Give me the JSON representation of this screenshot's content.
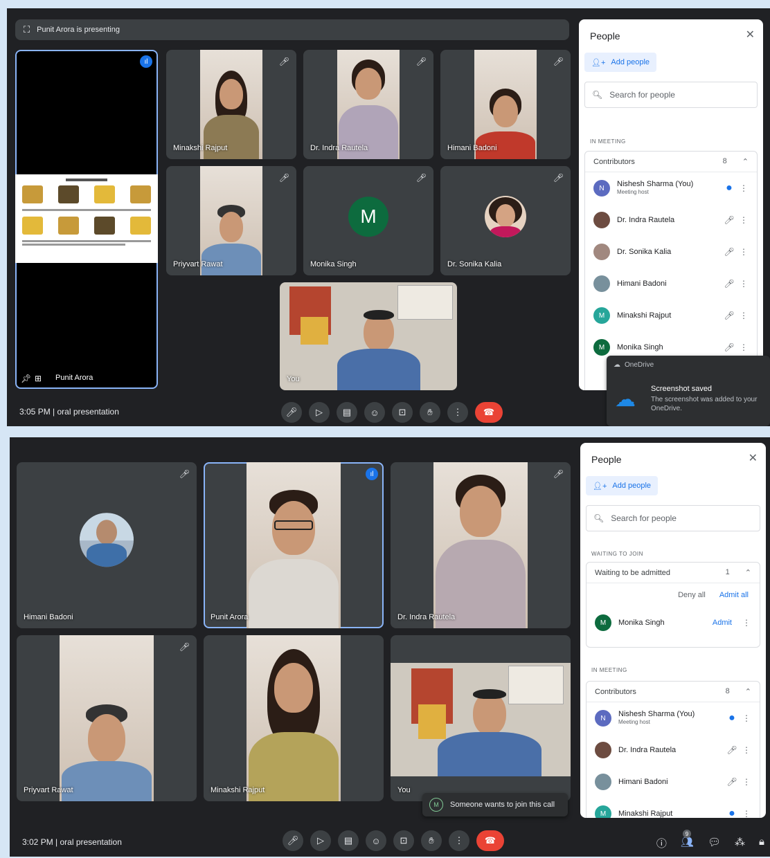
{
  "shot1": {
    "presenting_text": "Punit Arora is presenting",
    "tiles": [
      {
        "name": "Punit Arora"
      },
      {
        "name": "Minakshi Rajput"
      },
      {
        "name": "Dr. Indra Rautela"
      },
      {
        "name": "Himani Badoni"
      },
      {
        "name": "Priyvart Rawat"
      },
      {
        "name": "Monika Singh",
        "avatar_letter": "M"
      },
      {
        "name": "Dr. Sonika Kalia"
      },
      {
        "name": "You"
      }
    ],
    "meeting_info": "3:05 PM | oral presentation",
    "panel": {
      "title": "People",
      "add_people": "Add people",
      "search_placeholder": "Search for people",
      "section_label": "IN MEETING",
      "group_title": "Contributors",
      "group_count": "8",
      "people": [
        {
          "name": "Nishesh Sharma (You)",
          "sub": "Meeting host",
          "initial": "N"
        },
        {
          "name": "Dr. Indra Rautela"
        },
        {
          "name": "Dr. Sonika Kalia"
        },
        {
          "name": "Himani Badoni"
        },
        {
          "name": "Minakshi Rajput",
          "initial": "M"
        },
        {
          "name": "Monika Singh",
          "initial": "M"
        }
      ]
    },
    "toast": {
      "app": "OneDrive",
      "title": "Screenshot saved",
      "body": "The screenshot was added to your OneDrive."
    }
  },
  "shot2": {
    "tiles": [
      {
        "name": "Himani Badoni"
      },
      {
        "name": "Punit Arora"
      },
      {
        "name": "Dr. Indra Rautela"
      },
      {
        "name": "Priyvart Rawat"
      },
      {
        "name": "Minakshi Rajput"
      },
      {
        "name": "You"
      }
    ],
    "meeting_info": "3:02 PM | oral presentation",
    "badge_count": "9",
    "join_toast": "Someone wants to join this call",
    "panel": {
      "title": "People",
      "add_people": "Add people",
      "search_placeholder": "Search for people",
      "waiting_label": "WAITING TO JOIN",
      "waiting_group": "Waiting to be admitted",
      "waiting_count": "1",
      "deny_all": "Deny all",
      "admit_all": "Admit all",
      "waiting_person": {
        "name": "Monika Singh",
        "initial": "M",
        "admit": "Admit"
      },
      "section_label": "IN MEETING",
      "group_title": "Contributors",
      "group_count": "8",
      "people": [
        {
          "name": "Nishesh Sharma (You)",
          "sub": "Meeting host",
          "initial": "N"
        },
        {
          "name": "Dr. Indra Rautela"
        },
        {
          "name": "Himani Badoni"
        },
        {
          "name": "Minakshi Rajput",
          "initial": "M"
        }
      ]
    }
  }
}
